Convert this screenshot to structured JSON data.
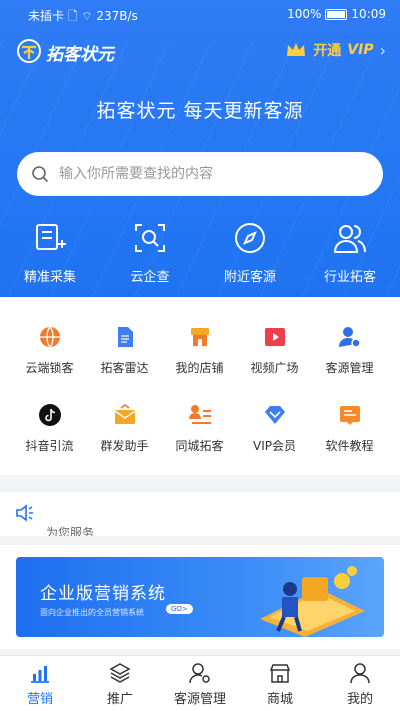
{
  "status_bar": {
    "left": "未插卡 🗋 ⌔ 237B/s",
    "battery": "100%",
    "time": "10:09"
  },
  "app": {
    "name": "拓客状元"
  },
  "vip": {
    "open": "开通",
    "label": "VIP",
    "chevron": "›"
  },
  "slogan": "拓客状元 每天更新客源",
  "search": {
    "placeholder": "输入你所需要查找的内容"
  },
  "quick_actions": [
    {
      "label": "精准采集",
      "icon": "collect-icon"
    },
    {
      "label": "云企查",
      "icon": "scan-icon"
    },
    {
      "label": "附近客源",
      "icon": "compass-icon"
    },
    {
      "label": "行业拓客",
      "icon": "users-icon"
    }
  ],
  "grid": {
    "row1": [
      {
        "label": "云端锁客",
        "icon": "globe-icon",
        "color": "#f07c2b"
      },
      {
        "label": "拓客雷达",
        "icon": "document-icon",
        "color": "#3d7ef7"
      },
      {
        "label": "我的店铺",
        "icon": "store-icon",
        "color": "#f5a623"
      },
      {
        "label": "视频广场",
        "icon": "video-icon",
        "color": "#ee3f4d"
      },
      {
        "label": "客源管理",
        "icon": "user-gear-icon",
        "color": "#2f6fe8"
      }
    ],
    "row2": [
      {
        "label": "抖音引流",
        "icon": "tiktok-icon",
        "color": "#111111"
      },
      {
        "label": "群发助手",
        "icon": "mail-icon",
        "color": "#f5a623"
      },
      {
        "label": "同城拓客",
        "icon": "contact-list-icon",
        "color": "#f07c2b"
      },
      {
        "label": "VIP会员",
        "icon": "diamond-icon",
        "color": "#3d7ef7"
      },
      {
        "label": "软件教程",
        "icon": "tutorial-icon",
        "color": "#f58a2b"
      }
    ]
  },
  "notice": {
    "text": "为您服务"
  },
  "banner": {
    "title": "企业版营销系统",
    "subtitle": "面向企业推出的全员营销系统",
    "go": "GO>"
  },
  "tabs": [
    {
      "label": "营销",
      "icon": "chart-icon",
      "active": true
    },
    {
      "label": "推广",
      "icon": "layers-icon",
      "active": false
    },
    {
      "label": "客源管理",
      "icon": "user-settings-icon",
      "active": false
    },
    {
      "label": "商城",
      "icon": "shop-icon",
      "active": false
    },
    {
      "label": "我的",
      "icon": "profile-icon",
      "active": false
    }
  ],
  "colors": {
    "primary": "#1f73f2",
    "vip_gold": "#ffcf3a"
  }
}
